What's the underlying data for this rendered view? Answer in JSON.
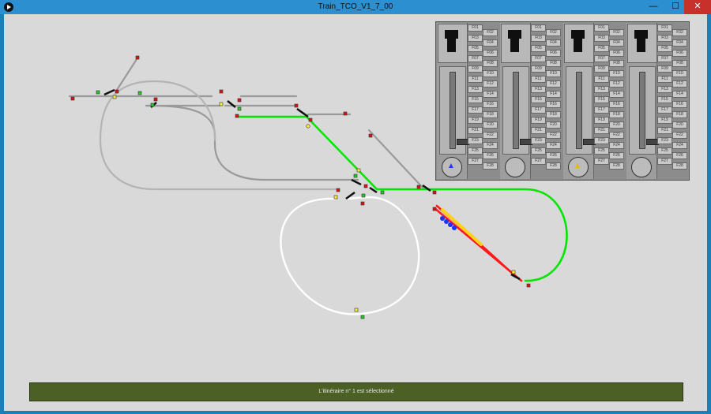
{
  "window": {
    "title": "Train_TCO_V1_7_00",
    "minimize_glyph": "—",
    "maximize_glyph": "☐",
    "close_glyph": "✕"
  },
  "status_bar": {
    "text": "L'itinéraire n° 1 est sélectionné"
  },
  "colors": {
    "track_grey": "#8f8f8f",
    "route_green": "#00e600",
    "route_red": "#ff1a1a",
    "train_yellow": "#ffd21a",
    "train_blue": "#1a33ff",
    "loop_white": "#ffffff",
    "status_bg": "#4c5f25"
  },
  "throttles": [
    {
      "direction": "▲",
      "direction_color": "#2233ff",
      "fkeys": [
        "F01",
        "F02",
        "F03",
        "F04",
        "F05",
        "F06",
        "F07",
        "F08",
        "F09",
        "F10",
        "F11",
        "F12",
        "F13",
        "F14",
        "F15",
        "F16",
        "F17",
        "F18",
        "F19",
        "F20",
        "F21",
        "F22",
        "F23",
        "F24",
        "F25",
        "F26",
        "F27",
        "F28"
      ]
    },
    {
      "direction": "",
      "direction_color": "#333333",
      "fkeys": [
        "F01",
        "F02",
        "F03",
        "F04",
        "F05",
        "F06",
        "F07",
        "F08",
        "F09",
        "F10",
        "F11",
        "F12",
        "F13",
        "F14",
        "F15",
        "F16",
        "F17",
        "F18",
        "F19",
        "F20",
        "F21",
        "F22",
        "F23",
        "F24",
        "F25",
        "F26",
        "F27",
        "F28"
      ]
    },
    {
      "direction": "▲",
      "direction_color": "#e6b800",
      "fkeys": [
        "F01",
        "F02",
        "F03",
        "F04",
        "F05",
        "F06",
        "F07",
        "F08",
        "F09",
        "F10",
        "F11",
        "F12",
        "F13",
        "F14",
        "F15",
        "F16",
        "F17",
        "F18",
        "F19",
        "F20",
        "F21",
        "F22",
        "F23",
        "F24",
        "F25",
        "F26",
        "F27",
        "F28"
      ]
    },
    {
      "direction": "",
      "direction_color": "#333333",
      "fkeys": [
        "F01",
        "F02",
        "F03",
        "F04",
        "F05",
        "F06",
        "F07",
        "F08",
        "F09",
        "F10",
        "F11",
        "F12",
        "F13",
        "F14",
        "F15",
        "F16",
        "F17",
        "F18",
        "F19",
        "F20",
        "F21",
        "F22",
        "F23",
        "F24",
        "F25",
        "F26",
        "F27",
        "F28"
      ]
    }
  ]
}
